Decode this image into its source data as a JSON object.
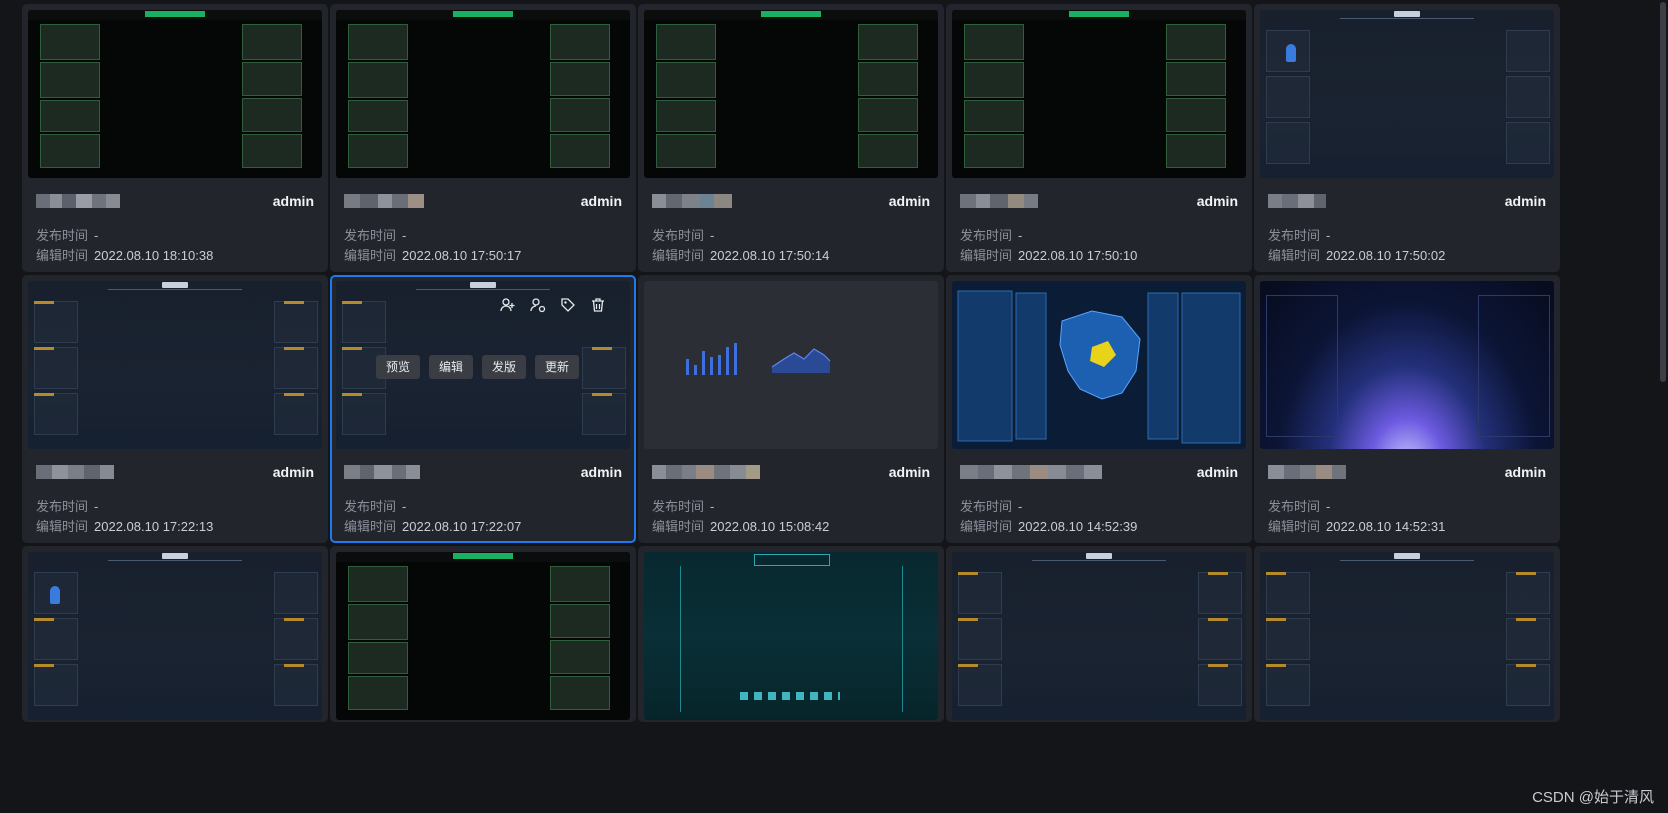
{
  "cards": [
    {
      "owner": "admin",
      "publish_label": "发布时间",
      "publish_value": "-",
      "edit_label": "编辑时间",
      "edit_value": "2022.08.10 18:10:38",
      "thumb": "green-dashboard"
    },
    {
      "owner": "admin",
      "publish_label": "发布时间",
      "publish_value": "-",
      "edit_label": "编辑时间",
      "edit_value": "2022.08.10 17:50:17",
      "thumb": "green-dashboard"
    },
    {
      "owner": "admin",
      "publish_label": "发布时间",
      "publish_value": "-",
      "edit_label": "编辑时间",
      "edit_value": "2022.08.10 17:50:14",
      "thumb": "green-dashboard"
    },
    {
      "owner": "admin",
      "publish_label": "发布时间",
      "publish_value": "-",
      "edit_label": "编辑时间",
      "edit_value": "2022.08.10 17:50:10",
      "thumb": "green-dashboard"
    },
    {
      "owner": "admin",
      "publish_label": "发布时间",
      "publish_value": "-",
      "edit_label": "编辑时间",
      "edit_value": "2022.08.10 17:50:02",
      "thumb": "frame-dashboard"
    },
    {
      "owner": "admin",
      "publish_label": "发布时间",
      "publish_value": "-",
      "edit_label": "编辑时间",
      "edit_value": "2022.08.10 17:22:13",
      "thumb": "frame-dashboard"
    },
    {
      "owner": "admin",
      "publish_label": "发布时间",
      "publish_value": "-",
      "edit_label": "编辑时间",
      "edit_value": "2022.08.10 17:22:07",
      "thumb": "frame-dashboard"
    },
    {
      "owner": "admin",
      "publish_label": "发布时间",
      "publish_value": "-",
      "edit_label": "编辑时间",
      "edit_value": "2022.08.10 15:08:42",
      "thumb": "charts"
    },
    {
      "owner": "admin",
      "publish_label": "发布时间",
      "publish_value": "-",
      "edit_label": "编辑时间",
      "edit_value": "2022.08.10 14:52:39",
      "thumb": "china-map"
    },
    {
      "owner": "admin",
      "publish_label": "发布时间",
      "publish_value": "-",
      "edit_label": "编辑时间",
      "edit_value": "2022.08.10 14:52:31",
      "thumb": "earth"
    }
  ],
  "bottom_row": [
    {
      "thumb": "frame-dashboard"
    },
    {
      "thumb": "green-dashboard"
    },
    {
      "thumb": "teal-dashboard"
    },
    {
      "thumb": "frame-dashboard"
    },
    {
      "thumb": "frame-dashboard"
    }
  ],
  "hover_actions": {
    "preview": "预览",
    "edit": "编辑",
    "publish": "发版",
    "update": "更新"
  },
  "hover_icons": [
    "add-user-icon",
    "user-settings-icon",
    "tag-icon",
    "trash-icon"
  ],
  "watermark": "CSDN @始于清风",
  "colors": {
    "selected_border": "#1d7af0",
    "card_bg": "#22252c",
    "page_bg": "#141519"
  }
}
